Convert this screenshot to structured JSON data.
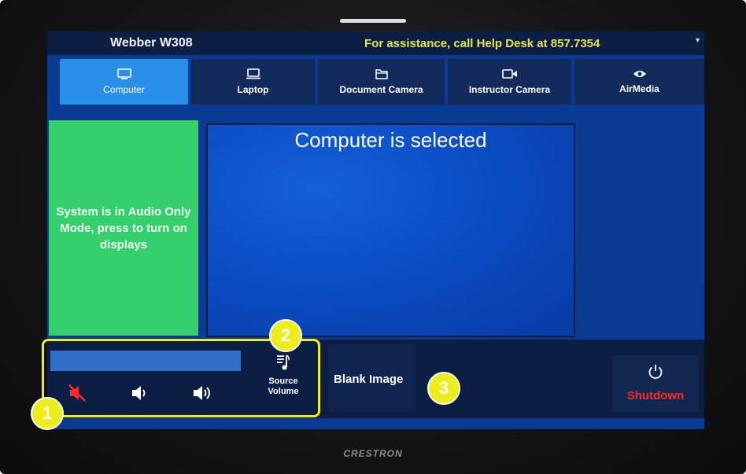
{
  "header": {
    "room": "Webber W308",
    "help": "For assistance, call Help Desk at 857.7354"
  },
  "tabs": [
    {
      "label": "Computer",
      "icon": "monitor-icon",
      "active": true
    },
    {
      "label": "Laptop",
      "icon": "laptop-icon",
      "active": false
    },
    {
      "label": "Document Camera",
      "icon": "folder-icon",
      "active": false
    },
    {
      "label": "Instructor Camera",
      "icon": "video-camera-icon",
      "active": false
    },
    {
      "label": "AirMedia",
      "icon": "eye-icon",
      "active": false
    }
  ],
  "main": {
    "audio_only_text": "System is in Audio Only Mode, press to turn on displays",
    "preview_title": "Computer is selected"
  },
  "controls": {
    "source_volume_label": "Source Volume",
    "blank_image_label": "Blank Image",
    "shutdown_label": "Shutdown"
  },
  "callouts": [
    "1",
    "2",
    "3"
  ],
  "device": {
    "brand": "CRESTRON"
  },
  "colors": {
    "active_tab": "#2a8fe8",
    "audio_panel": "#35d06d",
    "shutdown_text": "#ff2a24",
    "callout": "#ecec1e"
  }
}
